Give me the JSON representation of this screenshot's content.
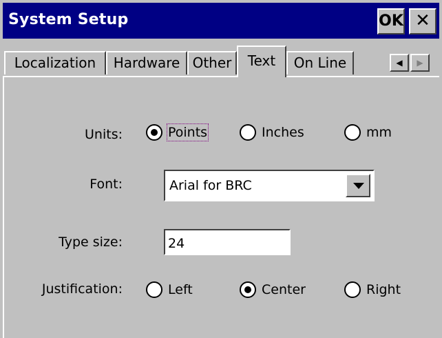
{
  "window": {
    "title": "System Setup",
    "ok_label": "OK",
    "close_label": "✕"
  },
  "tabs": [
    {
      "label": "Localization",
      "active": false
    },
    {
      "label": "Hardware",
      "active": false
    },
    {
      "label": "Other",
      "active": false
    },
    {
      "label": "Text",
      "active": true
    },
    {
      "label": "On Line",
      "active": false
    }
  ],
  "tab_scroll": {
    "left_icon": "◀",
    "right_icon": "▶"
  },
  "form": {
    "units": {
      "label": "Units:",
      "options": [
        "Points",
        "Inches",
        "mm"
      ],
      "selected": "Points"
    },
    "font": {
      "label": "Font:",
      "value": "Arial for BRC"
    },
    "type_size": {
      "label": "Type size:",
      "value": "24"
    },
    "justification": {
      "label": "Justification:",
      "options": [
        "Left",
        "Center",
        "Right"
      ],
      "selected": "Center"
    }
  },
  "colors": {
    "titlebar": "#000084",
    "face": "#c0c0c0",
    "title_text": "#ffffff"
  }
}
